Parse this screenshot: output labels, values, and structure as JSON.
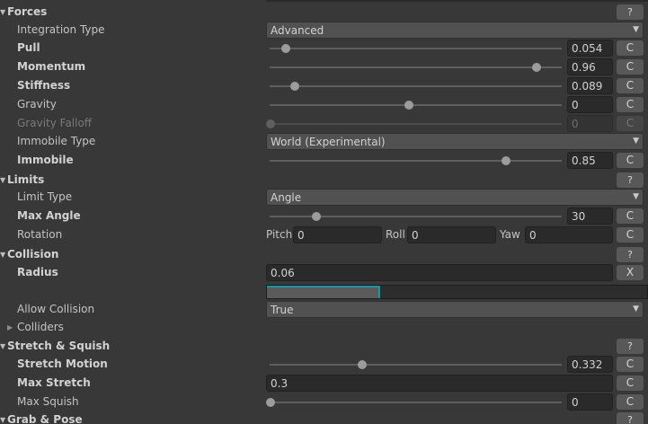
{
  "sections": {
    "forces": {
      "title": "Forces",
      "help": "?"
    },
    "limits": {
      "title": "Limits",
      "help": "?"
    },
    "collision": {
      "title": "Collision",
      "help": "?"
    },
    "stretch": {
      "title": "Stretch & Squish",
      "help": "?"
    },
    "grab": {
      "title": "Grab & Pose",
      "help": "?"
    }
  },
  "icons": {
    "expanded": "triangle-down",
    "collapsed": "triangle-right",
    "dropdown": "dropdown-arrow"
  },
  "glyphs": {
    "expanded": "▼",
    "collapsed": "▶",
    "dropdown": "▼"
  },
  "colors": {
    "panel": "#383838",
    "field": "#2a2a2a",
    "button": "#585858",
    "accent": "#00b5c8"
  },
  "forces": {
    "integration_type": {
      "label": "Integration Type",
      "value": "Advanced"
    },
    "pull": {
      "label": "Pull",
      "value": "0.054",
      "slider": 0.054,
      "button": "C"
    },
    "momentum": {
      "label": "Momentum",
      "value": "0.96",
      "slider": 0.96,
      "button": "C"
    },
    "stiffness": {
      "label": "Stiffness",
      "value": "0.089",
      "slider": 0.089,
      "button": "C"
    },
    "gravity": {
      "label": "Gravity",
      "value": "0",
      "slider": 0.5,
      "button": "C"
    },
    "gravity_falloff": {
      "label": "Gravity Falloff",
      "value": "0",
      "slider": 0,
      "button": "C"
    },
    "immobile_type": {
      "label": "Immobile Type",
      "value": "World (Experimental)"
    },
    "immobile": {
      "label": "Immobile",
      "value": "0.85",
      "slider": 0.85,
      "button": "C"
    }
  },
  "limits": {
    "limit_type": {
      "label": "Limit Type",
      "value": "Angle"
    },
    "max_angle": {
      "label": "Max Angle",
      "value": "30",
      "slider": 0.1667,
      "button": "C"
    },
    "rotation": {
      "label": "Rotation",
      "pitch_label": "Pitch",
      "pitch": "0",
      "roll_label": "Roll",
      "roll": "0",
      "yaw_label": "Yaw",
      "yaw": "0",
      "button": "C"
    }
  },
  "collision": {
    "radius": {
      "label": "Radius",
      "value": "0.06",
      "button": "X"
    },
    "allow_collision": {
      "label": "Allow Collision",
      "value": "True"
    },
    "colliders": {
      "label": "Colliders"
    }
  },
  "stretch": {
    "stretch_motion": {
      "label": "Stretch Motion",
      "value": "0.332",
      "slider": 0.332,
      "button": "C"
    },
    "max_stretch": {
      "label": "Max Stretch",
      "value": "0.3",
      "button": "C"
    },
    "max_squish": {
      "label": "Max Squish",
      "value": "0",
      "slider": 0,
      "button": "C"
    }
  }
}
